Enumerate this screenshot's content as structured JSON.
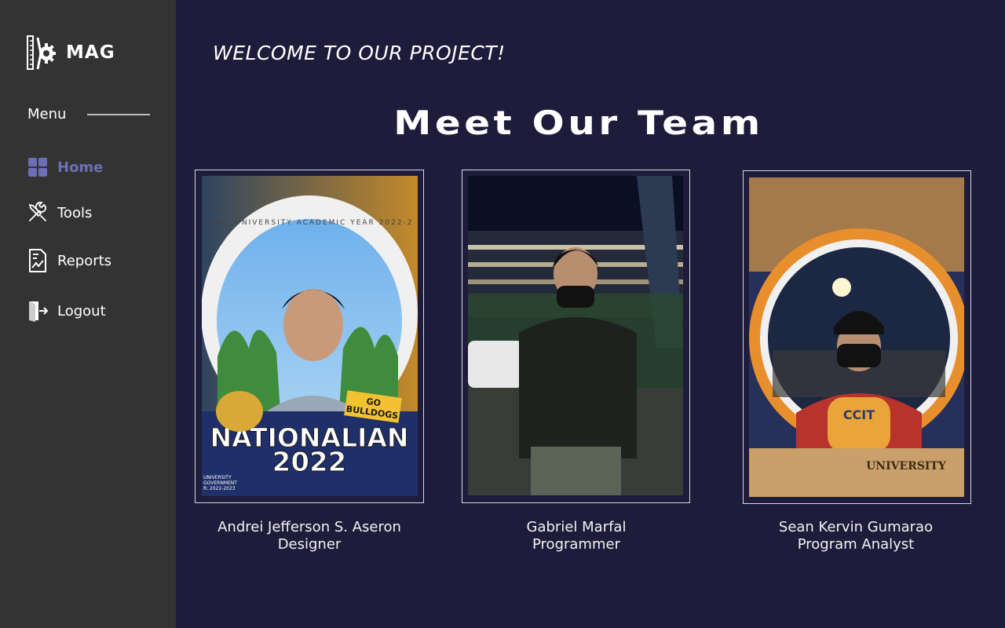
{
  "app": {
    "logo_text": "MAG"
  },
  "sidebar": {
    "menu_heading": "Menu",
    "items": [
      {
        "label": "Home",
        "icon": "grid-icon",
        "active": true
      },
      {
        "label": "Tools",
        "icon": "tools-icon",
        "active": false
      },
      {
        "label": "Reports",
        "icon": "report-icon",
        "active": false
      },
      {
        "label": "Logout",
        "icon": "logout-icon",
        "active": false
      }
    ]
  },
  "main": {
    "welcome": "WELCOME TO OUR PROJECT!",
    "title": "Meet Our Team",
    "team": [
      {
        "name": "Andrei Jefferson S. Aseron",
        "role": "Designer",
        "photo_text": [
          "NATIONALIAN",
          "2022",
          "GO BULLDOGS",
          "ONAL UNIVERSITY ACADEMIC YEAR 2022-2",
          "UNIVERSITY",
          "GOVERNMENT",
          "R: 2022-2023"
        ]
      },
      {
        "name": "Gabriel Marfal",
        "role": "Programmer"
      },
      {
        "name": "Sean Kervin Gumarao",
        "role": "Program Analyst",
        "photo_text": [
          "CCIT",
          "UNIVERSITY"
        ]
      }
    ]
  },
  "colors": {
    "sidebar_bg": "#333333",
    "main_bg": "#1e1c3a",
    "active_nav": "#6e6eb8"
  }
}
